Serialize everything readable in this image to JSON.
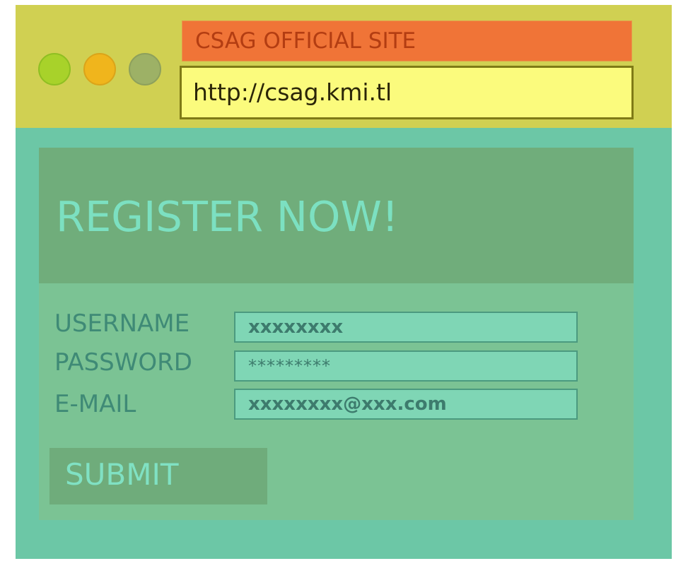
{
  "window": {
    "controls": {
      "close_color": "#a8d22a",
      "minimize_color": "#f0b51c",
      "maximize_color": "#9db166"
    },
    "tab": {
      "title": "CSAG OFFICIAL SITE"
    },
    "address_bar": {
      "url": "http://csag.kmi.tl"
    }
  },
  "page": {
    "heading": "REGISTER NOW!",
    "form": {
      "fields": [
        {
          "label": "USERNAME",
          "value": "xxxxxxxx"
        },
        {
          "label": "PASSWORD",
          "value": "*********"
        },
        {
          "label": "E-MAIL",
          "value": "xxxxxxxx@xxx.com"
        }
      ],
      "submit_label": "SUBMIT"
    }
  },
  "colors": {
    "titlebar": "#d0d052",
    "tab": "#f07437",
    "address_bar": "#fbfb7d",
    "page_background": "#6cc7a6",
    "hero_background": "#70ad7b",
    "form_background": "#7bc394",
    "heading_text": "#7ce0c1"
  }
}
